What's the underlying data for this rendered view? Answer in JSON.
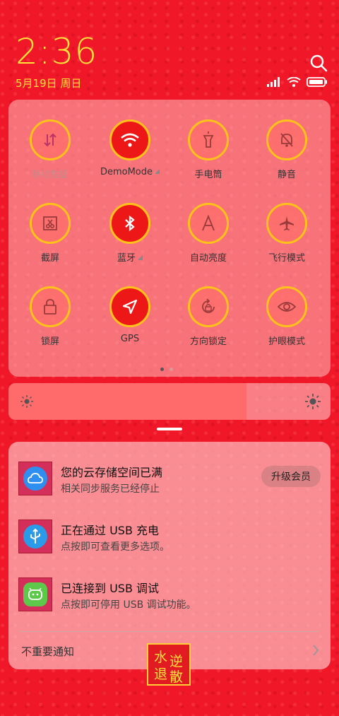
{
  "status": {
    "time": "2:36",
    "date": "5月19日 周日"
  },
  "tiles": [
    {
      "label": "移动数据",
      "state": "dim"
    },
    {
      "label": "DemoMode",
      "state": "on"
    },
    {
      "label": "手电筒",
      "state": "off"
    },
    {
      "label": "静音",
      "state": "off"
    },
    {
      "label": "截屏",
      "state": "off"
    },
    {
      "label": "蓝牙",
      "state": "on"
    },
    {
      "label": "自动亮度",
      "state": "off"
    },
    {
      "label": "飞行模式",
      "state": "off"
    },
    {
      "label": "锁屏",
      "state": "off"
    },
    {
      "label": "GPS",
      "state": "on"
    },
    {
      "label": "方向锁定",
      "state": "off"
    },
    {
      "label": "护眼模式",
      "state": "off"
    }
  ],
  "brightness": {
    "level": 0.74
  },
  "notifications": [
    {
      "title": "您的云存储空间已满",
      "body": "相关同步服务已经停止",
      "action": "升级会员"
    },
    {
      "title": "正在通过 USB 充电",
      "body": "点按即可查看更多选项。"
    },
    {
      "title": "已连接到 USB 调试",
      "body": "点按即可停用 USB 调试功能。"
    }
  ],
  "footer": {
    "unimportant_label": "不重要通知"
  },
  "watermark": {
    "text": "水逆退散"
  }
}
